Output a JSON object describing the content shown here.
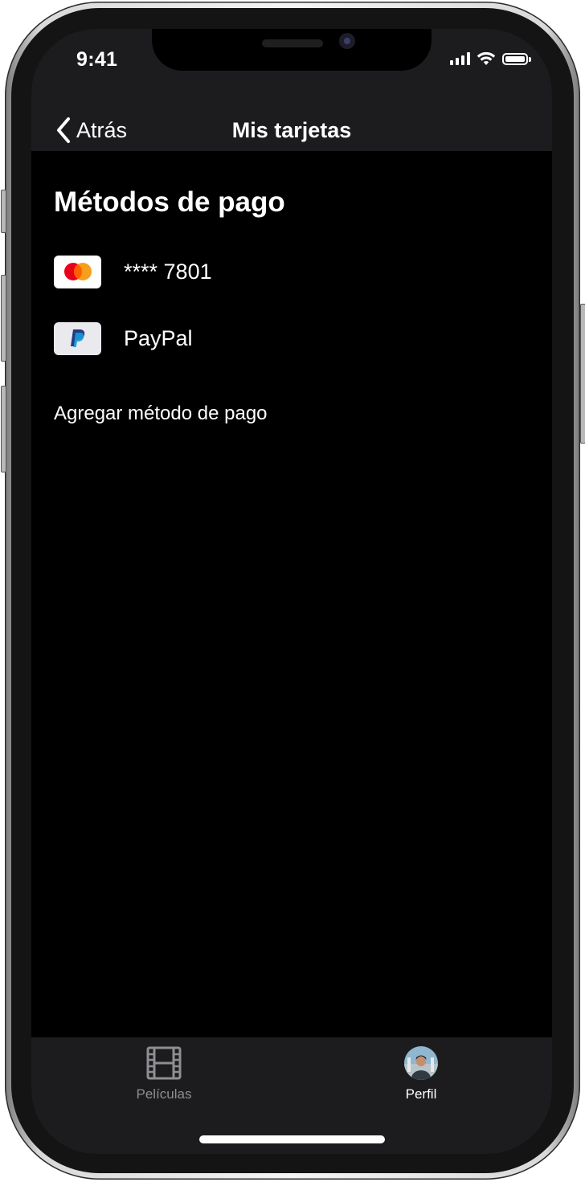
{
  "colors": {
    "screen_background": "#000000",
    "bar_background": "#1c1c1e",
    "text_primary": "#ffffff",
    "tab_inactive": "#8e8e93",
    "mastercard_red": "#eb001b",
    "mastercard_orange": "#f79e1b",
    "paypal_dark": "#253b80",
    "paypal_light": "#179bd7"
  },
  "status_bar": {
    "time": "9:41",
    "icons": [
      "cellular-signal-icon",
      "wifi-icon",
      "battery-icon"
    ]
  },
  "nav": {
    "back_label": "Atrás",
    "back_icon": "chevron-left-icon",
    "title": "Mis tarjetas"
  },
  "payment": {
    "section_title": "Métodos de pago",
    "methods": [
      {
        "icon": "mastercard-icon",
        "label": "**** 7801"
      },
      {
        "icon": "paypal-icon",
        "label": "PayPal"
      }
    ],
    "add_label": "Agregar método de pago"
  },
  "tabbar": {
    "tabs": [
      {
        "icon": "film-icon",
        "label": "Películas",
        "active": false
      },
      {
        "icon": "avatar",
        "label": "Perfil",
        "active": true
      }
    ]
  }
}
